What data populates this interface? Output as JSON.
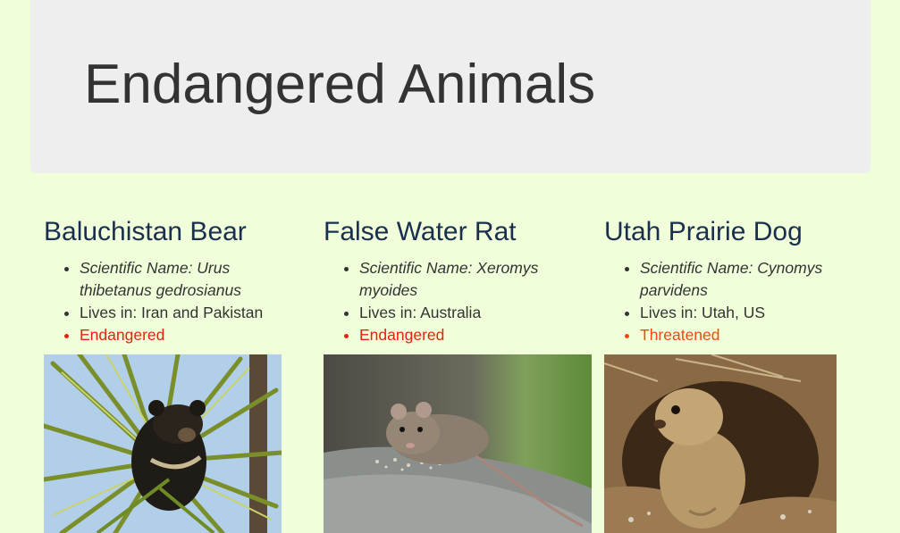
{
  "header": {
    "title": "Endangered Animals"
  },
  "animals": [
    {
      "name": "Baluchistan Bear",
      "scientific": "Scientific Name: Urus thibetanus gedrosianus",
      "lives": "Lives in: Iran and Pakistan",
      "status": "Endangered",
      "photo_icon": "bear-in-palm-tree"
    },
    {
      "name": "False Water Rat",
      "scientific": "Scientific Name: Xeromys myoides",
      "lives": "Lives in: Australia",
      "status": "Endangered",
      "photo_icon": "rat-on-rock"
    },
    {
      "name": "Utah Prairie Dog",
      "scientific": "Scientific Name: Cynomys parvidens",
      "lives": "Lives in: Utah, US",
      "status": "Threatened",
      "photo_icon": "prairie-dog-at-burrow"
    }
  ],
  "colors": {
    "background": "#f0ffd9",
    "jumbotron": "#eeeeee",
    "heading": "#1a2e4f",
    "status_endangered": "#e8210e",
    "status_threatened": "#f04a12"
  }
}
